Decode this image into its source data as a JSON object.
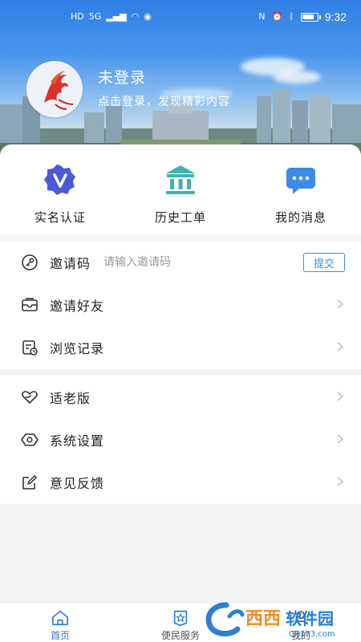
{
  "status_bar": {
    "time": "9:32",
    "network": "5G",
    "battery_level": 0.8
  },
  "profile": {
    "name": "未登录",
    "tip": "点击登录，发现精彩内容"
  },
  "quick_actions": [
    {
      "label": "实名认证",
      "icon": "verified-badge-icon",
      "color": "#4b5bd6"
    },
    {
      "label": "历史工单",
      "icon": "bank-building-icon",
      "color": "#3fb3b0"
    },
    {
      "label": "我的消息",
      "icon": "chat-bubble-icon",
      "color": "#3d8be6"
    }
  ],
  "invite": {
    "label": "邀请码",
    "placeholder": "请输入邀请码",
    "submit": "提交"
  },
  "menu_group_1": [
    {
      "label": "邀请好友",
      "icon": "envelope-icon"
    },
    {
      "label": "浏览记录",
      "icon": "history-record-icon"
    }
  ],
  "menu_group_2": [
    {
      "label": "适老版",
      "icon": "heart-hands-icon"
    },
    {
      "label": "系统设置",
      "icon": "settings-hex-icon"
    },
    {
      "label": "意见反馈",
      "icon": "edit-feedback-icon"
    }
  ],
  "tabbar": [
    {
      "label": "首页",
      "icon": "home-icon",
      "active": true
    },
    {
      "label": "便民服务",
      "icon": "service-star-icon",
      "active": false
    },
    {
      "label": "我的",
      "icon": "profile-icon",
      "active": false
    }
  ],
  "watermark": {
    "brand": "西西",
    "brand2": "软件园",
    "domain": "CR173.com"
  },
  "colors": {
    "accent": "#2d7fd3",
    "sky_top": "#2f7ee3",
    "submit_border": "#3a8fd6"
  }
}
